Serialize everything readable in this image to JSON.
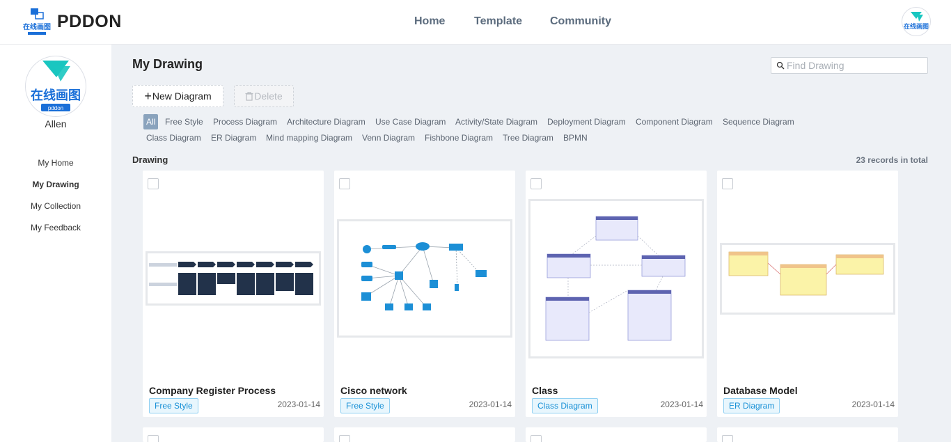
{
  "header": {
    "brand": "PDDON",
    "logo_text": "在线画图",
    "nav": [
      "Home",
      "Template",
      "Community"
    ]
  },
  "sidebar": {
    "avatar_text": "在线画图",
    "avatar_sub": "pddon",
    "username": "Allen",
    "items": [
      {
        "label": "My Home",
        "active": false
      },
      {
        "label": "My Drawing",
        "active": true
      },
      {
        "label": "My Collection",
        "active": false
      },
      {
        "label": "My Feedback",
        "active": false
      }
    ]
  },
  "main": {
    "title": "My Drawing",
    "search_placeholder": "Find Drawing",
    "new_button": "New Diagram",
    "delete_button": "Delete",
    "filters": [
      "All",
      "Free Style",
      "Process Diagram",
      "Architecture Diagram",
      "Use Case Diagram",
      "Activity/State Diagram",
      "Deployment Diagram",
      "Component Diagram",
      "Sequence Diagram",
      "Class Diagram",
      "ER Diagram",
      "Mind mapping Diagram",
      "Venn Diagram",
      "Fishbone Diagram",
      "Tree Diagram",
      "BPMN"
    ],
    "active_filter": "All",
    "section_label": "Drawing",
    "records": "23 records in total"
  },
  "cards": [
    {
      "title": "Company Register Process",
      "tag": "Free Style",
      "date": "2023-01-14"
    },
    {
      "title": "Cisco network",
      "tag": "Free Style",
      "date": "2023-01-14"
    },
    {
      "title": "Class",
      "tag": "Class Diagram",
      "date": "2023-01-14"
    },
    {
      "title": "Database Model",
      "tag": "ER Diagram",
      "date": "2023-01-14"
    }
  ],
  "colors": {
    "accent": "#1890d6",
    "active_filter_bg": "#8aa3bd",
    "logo_teal": "#19c6c0",
    "logo_blue": "#1a6fd8"
  }
}
